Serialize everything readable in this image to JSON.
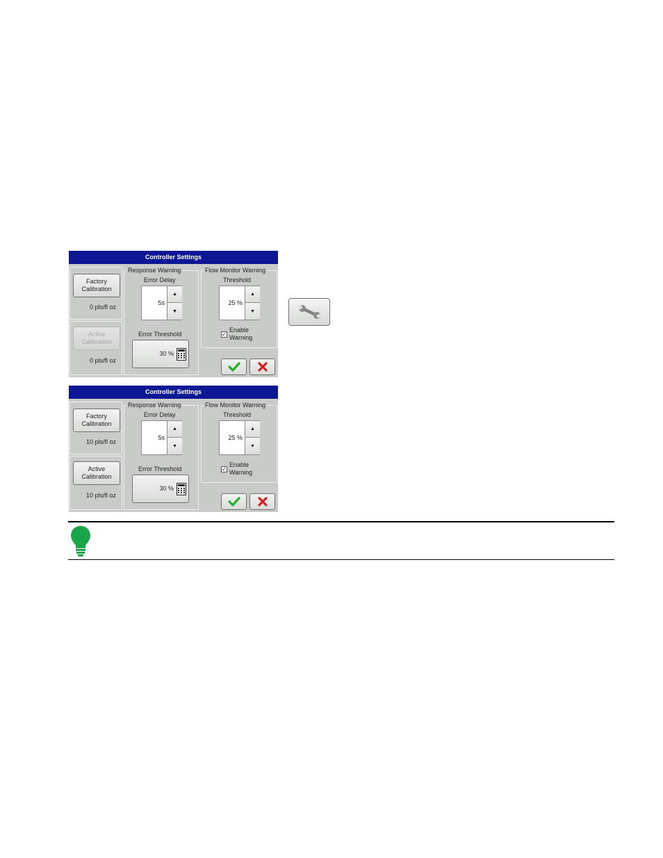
{
  "dialogs": [
    {
      "title": "Controller Settings",
      "factory_label": "Factory\nCalibration",
      "factory_value": "0 pls/fl oz",
      "active_label": "Active\nCalibration",
      "active_value": "0 pls/fl oz",
      "active_enabled": false,
      "response_legend": "Response Warning",
      "error_delay_label": "Error Delay",
      "error_delay_value": "5s",
      "error_threshold_label": "Error Threshold",
      "error_threshold_value": "30 %",
      "flow_legend": "Flow Monitor Warning",
      "threshold_label": "Threshold",
      "threshold_value": "25 %",
      "enable_warning_label": "Enable\nWarning",
      "enable_warning_checked": true
    },
    {
      "title": "Controller Settings",
      "factory_label": "Factory\nCalibration",
      "factory_value": "10 pls/fl oz",
      "active_label": "Active\nCalibration",
      "active_value": "10 pls/fl oz",
      "active_enabled": true,
      "response_legend": "Response Warning",
      "error_delay_label": "Error Delay",
      "error_delay_value": "5s",
      "error_threshold_label": "Error Threshold",
      "error_threshold_value": "30 %",
      "flow_legend": "Flow Monitor Warning",
      "threshold_label": "Threshold",
      "threshold_value": "25 %",
      "enable_warning_label": "Enable\nWarning",
      "enable_warning_checked": true
    }
  ],
  "icons": {
    "tool_button": "wrench-icon",
    "note": "lightbulb-icon",
    "accept": "checkmark-icon",
    "cancel": "x-icon"
  },
  "colors": {
    "title_bar": "#0d1794",
    "dialog_bg": "#c8cbc8",
    "accept_green": "#22b022",
    "cancel_red": "#d42020",
    "note_green": "#1aa54a"
  }
}
